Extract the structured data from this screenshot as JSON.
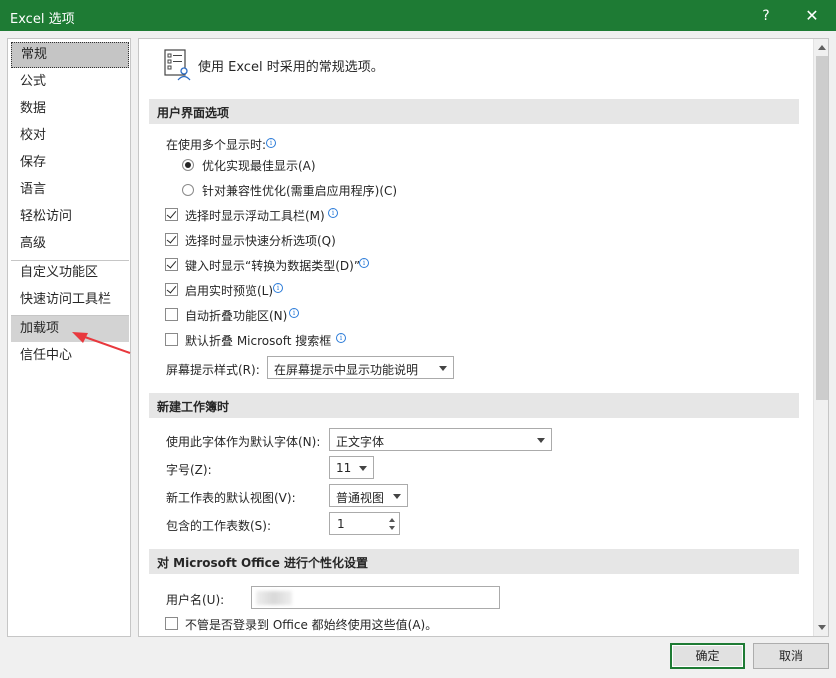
{
  "window": {
    "title": "Excel 选项",
    "help_label": "?",
    "close_label": "✕",
    "titlebar_color": "#1e7b34"
  },
  "nav": {
    "items": [
      {
        "label": "常规"
      },
      {
        "label": "公式"
      },
      {
        "label": "数据"
      },
      {
        "label": "校对"
      },
      {
        "label": "保存"
      },
      {
        "label": "语言"
      },
      {
        "label": "轻松访问"
      },
      {
        "label": "高级"
      },
      {
        "label": "自定义功能区"
      },
      {
        "label": "快速访问工具栏"
      },
      {
        "label": "加载项"
      },
      {
        "label": "信任中心"
      }
    ],
    "selected": "常规",
    "highlighted": "加载项"
  },
  "annotation": {
    "arrow_color": "#e8383d",
    "points_to": "加载项"
  },
  "content": {
    "intro": "使用 Excel 时采用的常规选项。",
    "ui_section": {
      "title": "用户界面选项",
      "multi_display_label": "在使用多个显示时:",
      "radio_best": "优化实现最佳显示(A)",
      "radio_compat": "针对兼容性优化(需重启应用程序)(C)",
      "radio_selected": "best",
      "checkboxes": [
        {
          "label": "选择时显示浮动工具栏(M)",
          "checked": true
        },
        {
          "label": "选择时显示快速分析选项(Q)",
          "checked": true
        },
        {
          "label": "键入时显示“转换为数据类型(D)”",
          "checked": true
        },
        {
          "label": "启用实时预览(L)",
          "checked": true
        },
        {
          "label": "自动折叠功能区(N)",
          "checked": false
        },
        {
          "label": "默认折叠 Microsoft 搜索框",
          "checked": false
        }
      ],
      "screentip_label": "屏幕提示样式(R):",
      "screentip_value": "在屏幕提示中显示功能说明"
    },
    "workbook_section": {
      "title": "新建工作簿时",
      "font_label": "使用此字体作为默认字体(N):",
      "font_value": "正文字体",
      "size_label": "字号(Z):",
      "size_value": "11",
      "view_label": "新工作表的默认视图(V):",
      "view_value": "普通视图",
      "sheets_label": "包含的工作表数(S):",
      "sheets_value": "1"
    },
    "personalize_section": {
      "title": "对 Microsoft Office 进行个性化设置",
      "username_label": "用户名(U):",
      "always_use_label": "不管是否登录到 Office 都始终使用这些值(A)。",
      "always_use_checked": false
    }
  },
  "footer": {
    "ok_label": "确定",
    "cancel_label": "取消"
  }
}
